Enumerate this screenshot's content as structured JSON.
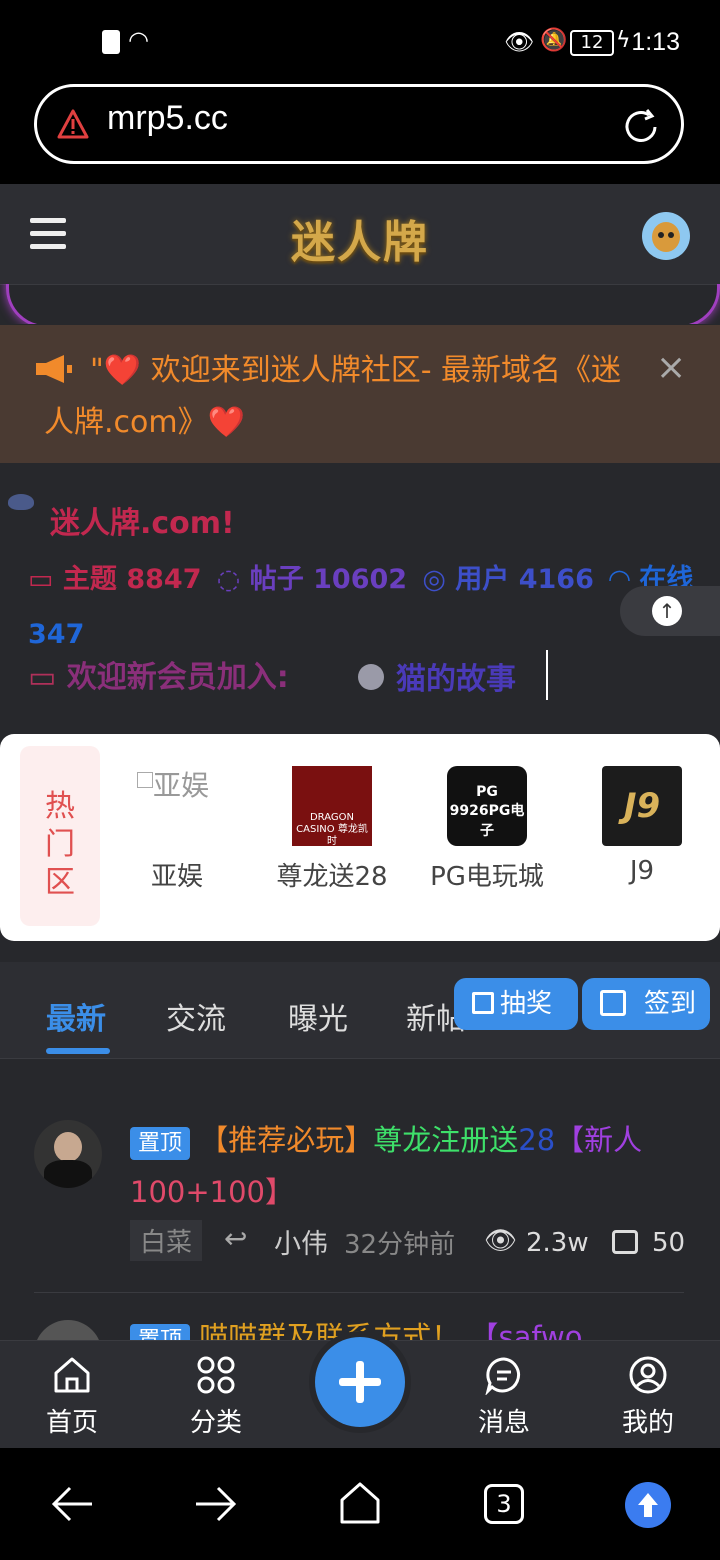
{
  "status": {
    "time": "1:13",
    "battery": "12"
  },
  "browser": {
    "url": "mrp5.cc",
    "tab_count": "3"
  },
  "site": {
    "logo_text": "迷人牌"
  },
  "notice": {
    "text": "\"❤️ 欢迎来到迷人牌社区- 最新域名《迷人牌.com》❤️",
    "close": "×"
  },
  "community": {
    "name": "迷人牌.com!",
    "stats": [
      {
        "label": "主题",
        "value": "8847",
        "color": "#c2284f"
      },
      {
        "label": "帖子",
        "value": "10602",
        "color": "#6a3fbf"
      },
      {
        "label": "用户",
        "value": "4166",
        "color": "#3d4fc9"
      },
      {
        "label": "在线",
        "value": "347",
        "color": "#1f66d8"
      }
    ],
    "welcome_label": "欢迎新会员加入:",
    "new_member": "猫的故事"
  },
  "hot": {
    "label": "热门区",
    "items": [
      {
        "name": "亚娱",
        "alt": "亚娱"
      },
      {
        "name": "尊龙送28",
        "img_text": "DRAGON CASINO 尊龙凯时"
      },
      {
        "name": "PG电玩城",
        "img_text": "PG 9926PG电子"
      },
      {
        "name": "J9",
        "img_text": "J9"
      }
    ]
  },
  "tabs": {
    "items": [
      "最新",
      "交流",
      "曝光",
      "新帖"
    ],
    "active": 0,
    "lottery": "抽奖",
    "checkin": "签到"
  },
  "posts": [
    {
      "badge": "置顶",
      "title_parts": [
        "【推荐必玩】",
        "尊龙注册送",
        "28",
        "【新人",
        "100+100】"
      ],
      "category": "白菜",
      "author": "小伟",
      "time": "32分钟前",
      "views": "2.3w",
      "comments": "50"
    },
    {
      "badge": "置顶",
      "title_parts": [
        "喵喵群及联系方式！",
        "【safwo"
      ]
    }
  ],
  "bottom_nav": {
    "home": "首页",
    "category": "分类",
    "messages": "消息",
    "mine": "我的"
  },
  "colors": {
    "accent": "#3b8ee8",
    "notice_text": "#f18a2b",
    "hot_red": "#e05050"
  }
}
